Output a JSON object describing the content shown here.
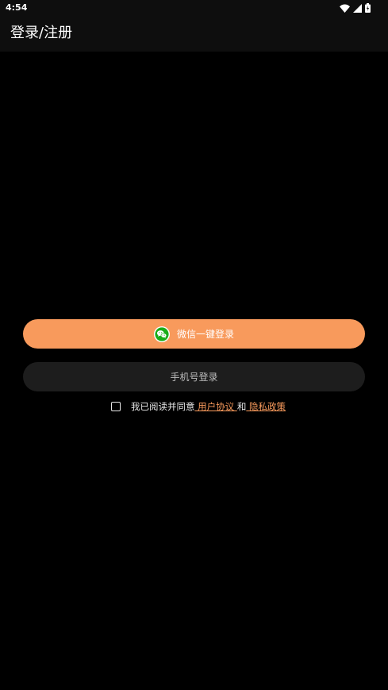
{
  "status_bar": {
    "time": "4:54",
    "icons": [
      "wifi-icon",
      "signal-icon",
      "battery-icon"
    ]
  },
  "app_bar": {
    "title": "登录/注册"
  },
  "login": {
    "wechat_label": "微信一键登录",
    "phone_label": "手机号登录"
  },
  "agreement": {
    "prefix": "我已阅读并同意",
    "user_agreement": " 用户协议 ",
    "conjunction": "和",
    "privacy_policy": " 隐私政策"
  },
  "colors": {
    "background": "#000000",
    "bar": "#0e0e0e",
    "accent": "#f89a5c",
    "secondary_button": "#1d1d1d",
    "wechat_green": "#1aad19"
  }
}
